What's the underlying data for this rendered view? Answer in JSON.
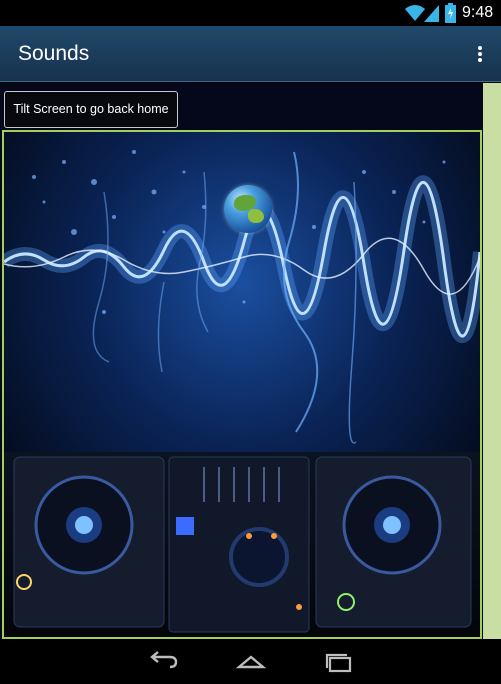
{
  "status_bar": {
    "time": "9:48",
    "icons": [
      "wifi-icon",
      "signal-icon",
      "battery-icon"
    ]
  },
  "action_bar": {
    "title": "Sounds",
    "overflow_icon": "more-vert-icon"
  },
  "content": {
    "home_button_label": "Tilt Screen to go back home",
    "stage": {
      "background": "dj-sound-wave-image",
      "ball_icon": "globe-icon",
      "border_color": "#a3d05a"
    },
    "side_strip_color": "#c9dea2"
  },
  "nav_bar": {
    "icons": [
      "back-icon",
      "home-icon",
      "recents-icon"
    ]
  },
  "colors": {
    "action_bar": "#1b3d5c",
    "accent": "#a3d05a"
  }
}
